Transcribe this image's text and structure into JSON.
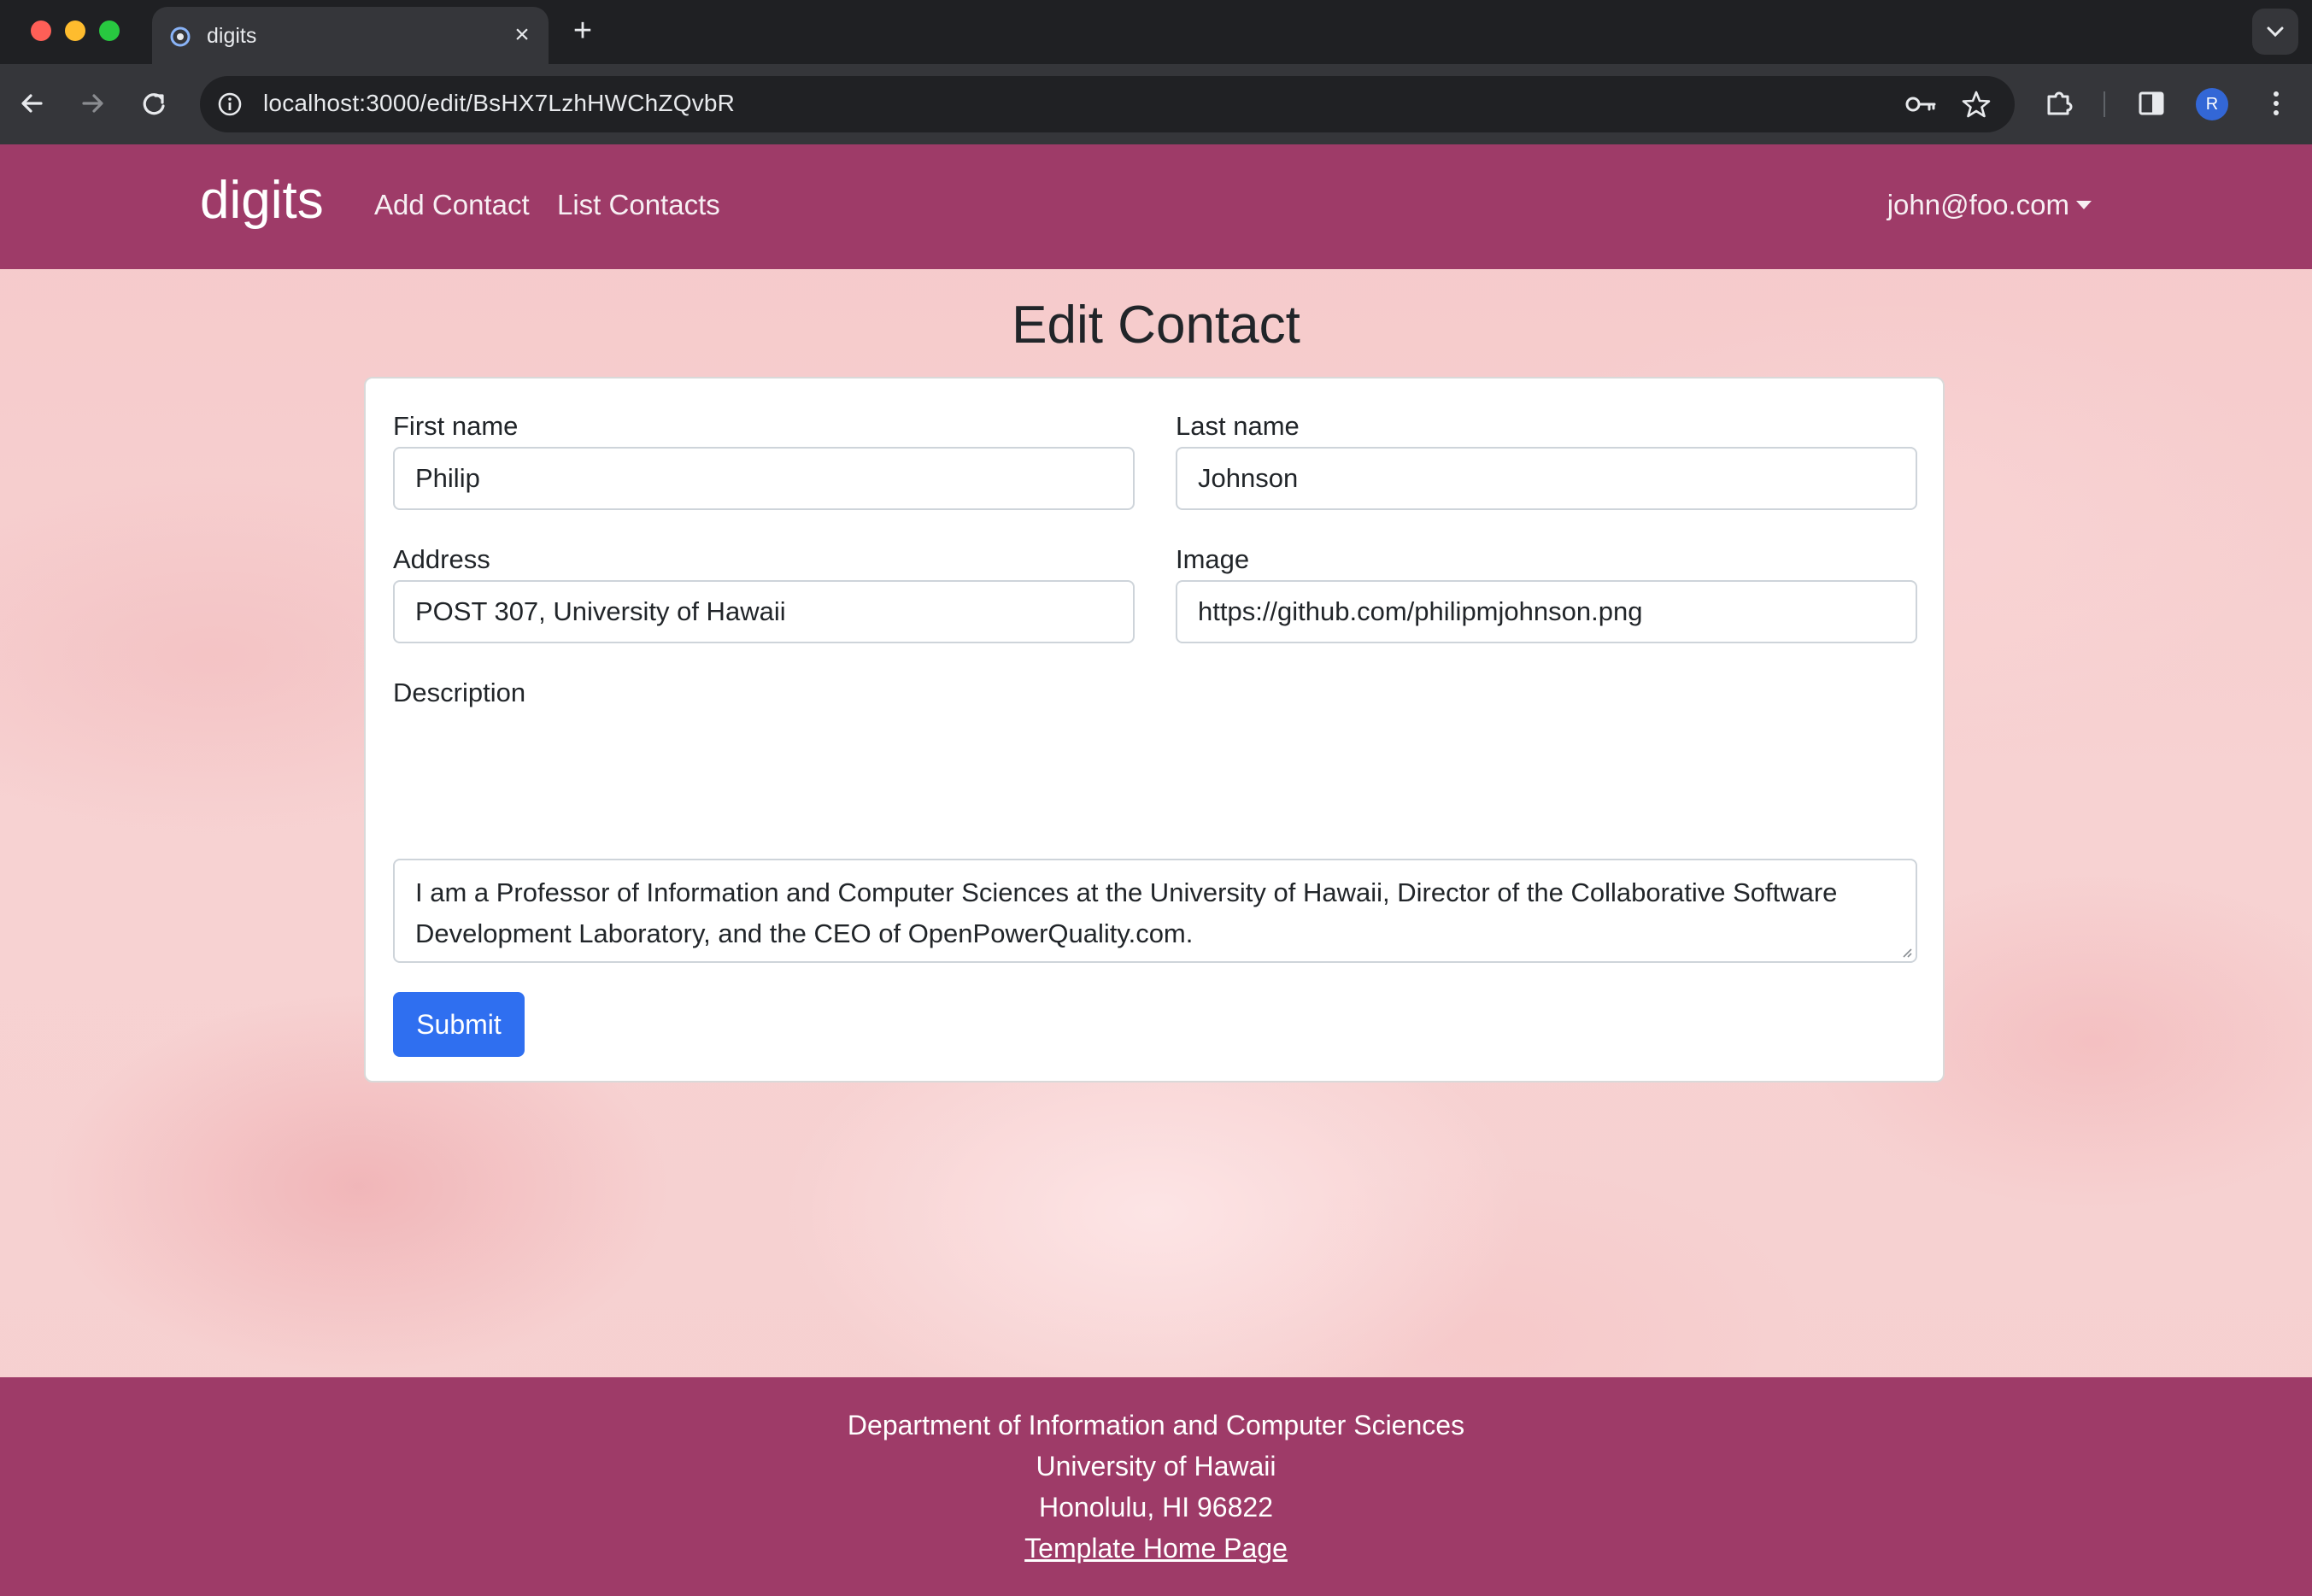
{
  "browser": {
    "tab_title": "digits",
    "url": "localhost:3000/edit/BsHX7LzhHWChZQvbR",
    "profile_initial": "R"
  },
  "nav": {
    "brand": "digits",
    "add_contact": "Add Contact",
    "list_contacts": "List Contacts",
    "user": "john@foo.com"
  },
  "page": {
    "title": "Edit Contact"
  },
  "form": {
    "first_name": {
      "label": "First name",
      "value": "Philip"
    },
    "last_name": {
      "label": "Last name",
      "value": "Johnson"
    },
    "address": {
      "label": "Address",
      "value": "POST 307, University of Hawaii"
    },
    "image": {
      "label": "Image",
      "value": "https://github.com/philipmjohnson.png"
    },
    "description": {
      "label": "Description",
      "value": "I am a Professor of Information and Computer Sciences at the University of Hawaii, Director of the Collaborative Software Development Laboratory, and the CEO of OpenPowerQuality.com."
    },
    "submit": "Submit"
  },
  "footer": {
    "line1": "Department of Information and Computer Sciences",
    "line2": "University of Hawaii",
    "line3": "Honolulu, HI 96822",
    "link": "Template Home Page"
  },
  "colors": {
    "navbar": "#9e3b68",
    "button": "#2f6ff0"
  }
}
